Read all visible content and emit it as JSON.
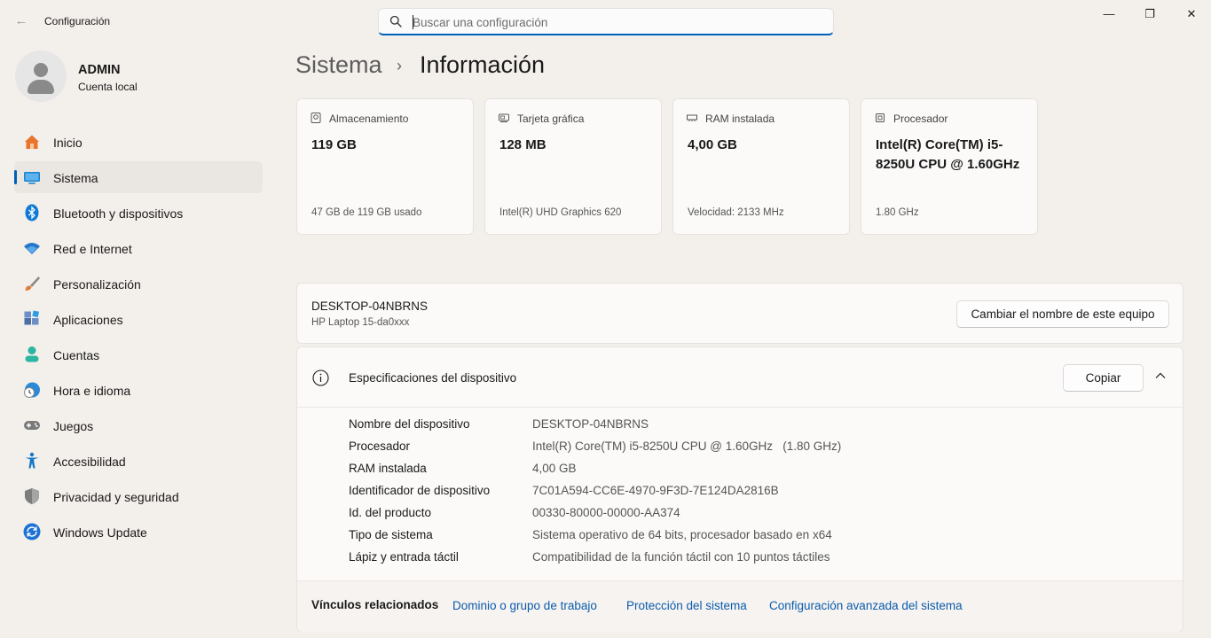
{
  "window": {
    "title": "Configuración",
    "controls": {
      "minimize": "—",
      "maximize": "❐",
      "close": "✕"
    }
  },
  "search": {
    "placeholder": "Buscar una configuración",
    "value": ""
  },
  "user": {
    "name": "ADMIN",
    "account_type": "Cuenta local"
  },
  "sidebar": {
    "items": [
      {
        "label": "Inicio",
        "icon": "home-icon",
        "color": "#e8742e"
      },
      {
        "label": "Sistema",
        "icon": "system-icon",
        "color": "#1a83d0",
        "active": true
      },
      {
        "label": "Bluetooth y dispositivos",
        "icon": "bluetooth-icon",
        "color": "#0e7ad6"
      },
      {
        "label": "Red e Internet",
        "icon": "wifi-icon",
        "color": "#2777c9"
      },
      {
        "label": "Personalización",
        "icon": "brush-icon",
        "color": "#e07b39"
      },
      {
        "label": "Aplicaciones",
        "icon": "apps-icon",
        "color": "#4c6fa8"
      },
      {
        "label": "Cuentas",
        "icon": "accounts-icon",
        "color": "#2cb5a0"
      },
      {
        "label": "Hora e idioma",
        "icon": "clock-globe-icon",
        "color": "#2a8ad6"
      },
      {
        "label": "Juegos",
        "icon": "gamepad-icon",
        "color": "#7a7a7a"
      },
      {
        "label": "Accesibilidad",
        "icon": "accessibility-icon",
        "color": "#1577c9"
      },
      {
        "label": "Privacidad y seguridad",
        "icon": "shield-icon",
        "color": "#7d7d7d"
      },
      {
        "label": "Windows Update",
        "icon": "update-icon",
        "color": "#1e72d3"
      }
    ]
  },
  "breadcrumb": {
    "parent": "Sistema",
    "separator": "›",
    "current": "Información"
  },
  "cards": [
    {
      "title": "Almacenamiento",
      "value": "119 GB",
      "sub": "47 GB de 119 GB usado",
      "icon": "storage-icon"
    },
    {
      "title": "Tarjeta gráfica",
      "value": "128 MB",
      "sub": "Intel(R) UHD Graphics 620",
      "icon": "gpu-icon"
    },
    {
      "title": "RAM instalada",
      "value": "4,00 GB",
      "sub": "Velocidad: 2133 MHz",
      "icon": "ram-icon"
    },
    {
      "title": "Procesador",
      "value": "Intel(R) Core(TM) i5-8250U CPU @ 1.60GHz",
      "sub": "1.80 GHz",
      "icon": "cpu-icon"
    }
  ],
  "device": {
    "name": "DESKTOP-04NBRNS",
    "model": "HP Laptop 15-da0xxx",
    "rename_button": "Cambiar el nombre de este equipo"
  },
  "specs": {
    "title": "Especificaciones del dispositivo",
    "copy_button": "Copiar",
    "rows": [
      {
        "key": "Nombre del dispositivo",
        "value": "DESKTOP-04NBRNS"
      },
      {
        "key": "Procesador",
        "value": "Intel(R) Core(TM) i5-8250U CPU @ 1.60GHz   (1.80 GHz)"
      },
      {
        "key": "RAM instalada",
        "value": "4,00 GB"
      },
      {
        "key": "Identificador de dispositivo",
        "value": "7C01A594-CC6E-4970-9F3D-7E124DA2816B"
      },
      {
        "key": "Id. del producto",
        "value": "00330-80000-00000-AA374"
      },
      {
        "key": "Tipo de sistema",
        "value": "Sistema operativo de 64 bits, procesador basado en x64"
      },
      {
        "key": "Lápiz y entrada táctil",
        "value": "Compatibilidad de la función táctil con 10 puntos táctiles"
      }
    ]
  },
  "related": {
    "label": "Vínculos relacionados",
    "links": [
      "Dominio o grupo de trabajo",
      "Protección del sistema",
      "Configuración avanzada del sistema"
    ]
  },
  "colors": {
    "accent": "#005fb8",
    "link": "#0b5cad",
    "background": "#f3efeb"
  }
}
